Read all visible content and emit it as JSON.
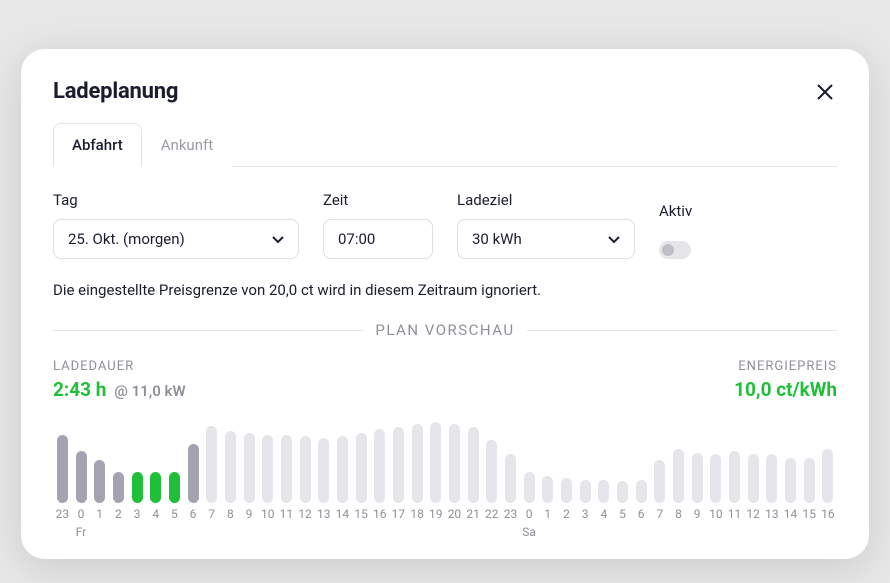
{
  "modal": {
    "title": "Ladeplanung",
    "tabs": {
      "departure": "Abfahrt",
      "arrival": "Ankunft",
      "active_tab": "departure"
    },
    "fields": {
      "day": {
        "label": "Tag",
        "value": "25. Okt. (morgen)"
      },
      "time": {
        "label": "Zeit",
        "value": "07:00"
      },
      "goal": {
        "label": "Ladeziel",
        "value": "30 kWh"
      },
      "active": {
        "label": "Aktiv",
        "value": false
      }
    },
    "hint": "Die eingestellte Preisgrenze von 20,0 ct wird in diesem Zeitraum ignoriert.",
    "preview": {
      "divider_label": "PLAN VORSCHAU",
      "duration_label": "LADEDAUER",
      "duration_value": "2:43 h",
      "power_suffix": "@ 11,0 kW",
      "price_label": "ENERGIEPREIS",
      "price_value": "10,0 ct/kWh"
    }
  },
  "colors": {
    "bar_inplan_solid": "#a3a4b0",
    "bar_inplan_green": "#1fbf3a",
    "bar_out": "#e6e6ea"
  },
  "chart_data": {
    "type": "bar",
    "title": "PLAN VORSCHAU",
    "xlabel": "",
    "ylabel": "",
    "ylim": [
      0,
      100
    ],
    "categories": [
      "23",
      "0",
      "1",
      "2",
      "3",
      "4",
      "5",
      "6",
      "7",
      "8",
      "9",
      "10",
      "11",
      "12",
      "13",
      "14",
      "15",
      "16",
      "17",
      "18",
      "19",
      "20",
      "21",
      "22",
      "23",
      "0",
      "1",
      "2",
      "3",
      "4",
      "5",
      "6",
      "7",
      "8",
      "9",
      "10",
      "11",
      "12",
      "13",
      "14",
      "15",
      "16"
    ],
    "day_labels": [
      "",
      "Fr",
      "",
      "",
      "",
      "",
      "",
      "",
      "",
      "",
      "",
      "",
      "",
      "",
      "",
      "",
      "",
      "",
      "",
      "",
      "",
      "",
      "",
      "",
      "",
      "Sa",
      "",
      "",
      "",
      "",
      "",
      "",
      "",
      "",
      "",
      "",
      "",
      "",
      "",
      "",
      "",
      ""
    ],
    "series": [
      {
        "name": "relative_price",
        "values": [
          76,
          58,
          48,
          34,
          34,
          34,
          34,
          66,
          86,
          80,
          78,
          76,
          76,
          74,
          72,
          74,
          78,
          82,
          84,
          88,
          90,
          88,
          84,
          70,
          54,
          34,
          30,
          28,
          26,
          26,
          24,
          26,
          48,
          60,
          56,
          54,
          58,
          54,
          54,
          50,
          50,
          60
        ]
      },
      {
        "name": "state",
        "values": [
          "in",
          "in",
          "in",
          "in",
          "green",
          "green",
          "green",
          "in",
          "out",
          "out",
          "out",
          "out",
          "out",
          "out",
          "out",
          "out",
          "out",
          "out",
          "out",
          "out",
          "out",
          "out",
          "out",
          "out",
          "out",
          "out",
          "out",
          "out",
          "out",
          "out",
          "out",
          "out",
          "out",
          "out",
          "out",
          "out",
          "out",
          "out",
          "out",
          "out",
          "out",
          "out"
        ]
      }
    ]
  }
}
